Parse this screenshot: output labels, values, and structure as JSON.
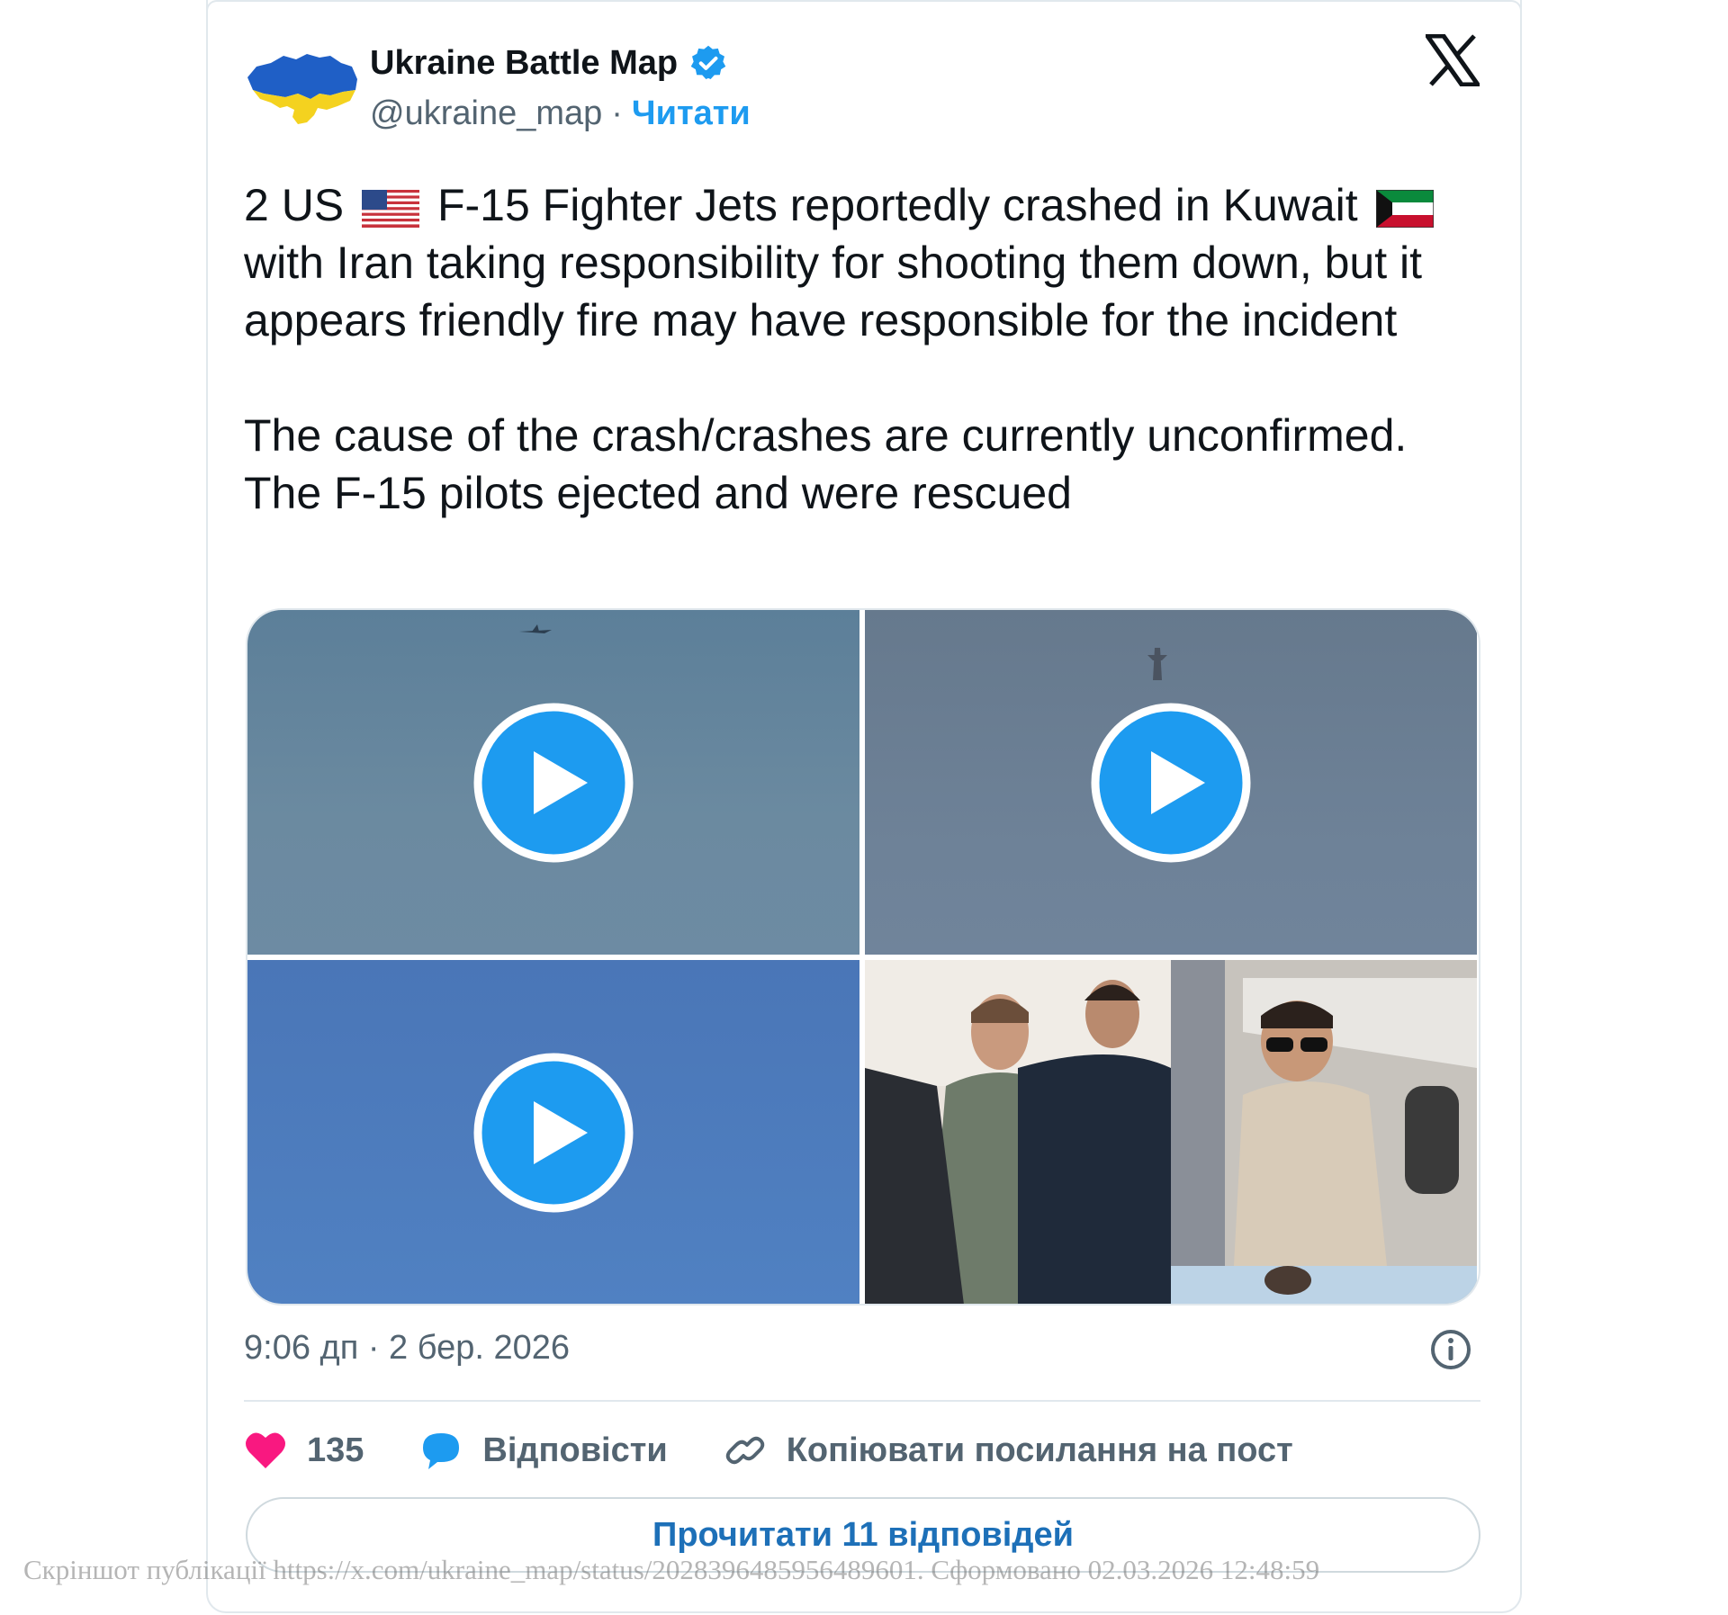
{
  "author": {
    "name": "Ukraine Battle Map",
    "handle": "@ukraine_map",
    "separator": "·",
    "follow_label": "Читати",
    "avatar_icon": "ukraine-map-icon",
    "verified_icon": "verified-badge-icon"
  },
  "platform_logo": "x-logo-icon",
  "tweet": {
    "para1_a": "2 US",
    "para1_b": "F-15 Fighter Jets reportedly crashed in Kuwait",
    "para1_c": "with Iran taking responsibility for shooting them down, but it appears friendly fire may have responsible for the incident",
    "para2": "The cause of the crash/crashes are currently unconfirmed. The F-15 pilots ejected and were rescued"
  },
  "media": [
    {
      "type": "video",
      "icon": "play-icon"
    },
    {
      "type": "video",
      "icon": "play-icon"
    },
    {
      "type": "video",
      "icon": "play-icon"
    },
    {
      "type": "image"
    }
  ],
  "timestamp": "9:06 дп · 2 бер. 2026",
  "actions": {
    "like_count": "135",
    "reply_label": "Відповісти",
    "copy_label": "Копіювати посилання на пост"
  },
  "read_replies_label": "Прочитати 11 відповідей",
  "watermark": "Скріншот публікації https://x.com/ukraine_map/status/2028396485956489601. Сформовано 02.03.2026 12:48:59",
  "colors": {
    "accent": "#1d9bf0",
    "like": "#f91880",
    "text": "#0f1419",
    "muted": "#536471"
  }
}
